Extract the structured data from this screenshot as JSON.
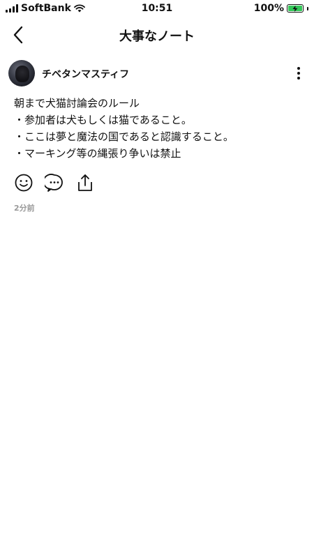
{
  "status_bar": {
    "carrier": "SoftBank",
    "time": "10:51",
    "battery": "100%",
    "battery_color": "#34c759"
  },
  "nav": {
    "title": "大事なノート",
    "back_icon": "chevron-left-icon"
  },
  "post": {
    "author": "チベタンマスティフ",
    "lines": [
      "朝まで犬猫討論会のルール",
      "・参加者は犬もしくは猫であること。",
      "・ここは夢と魔法の国であると認識すること。",
      "・マーキング等の縄張り争いは禁止"
    ],
    "timestamp": "2分前",
    "actions": [
      "smiley-icon",
      "comment-icon",
      "share-icon"
    ],
    "more_icon": "more-vertical-icon"
  }
}
